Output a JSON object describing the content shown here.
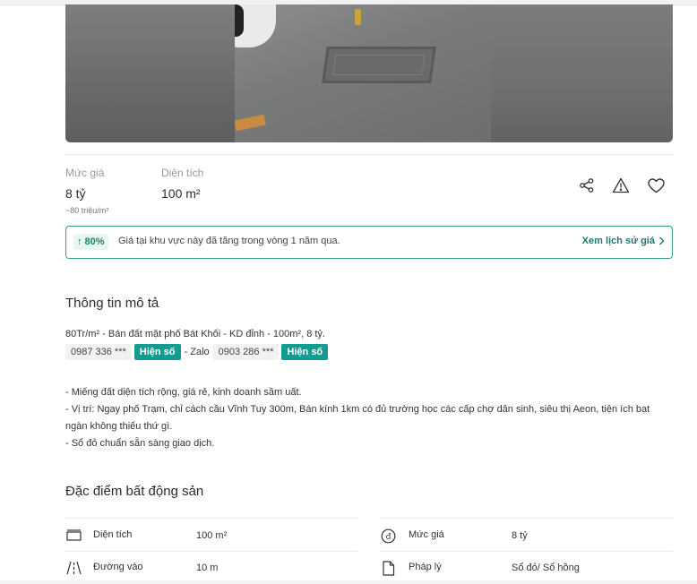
{
  "price_block": {
    "price_label": "Mức giá",
    "price_value": "8 tỷ",
    "price_per_m2": "~80 triệu/m²",
    "area_label": "Diện tích",
    "area_value": "100 m²",
    "icons": [
      "share-icon",
      "warning-icon",
      "heart-icon"
    ]
  },
  "trend_banner": {
    "badge": "↑ 80%",
    "text": "Giá tại khu vực này đã tăng trong vòng 1 năm qua.",
    "link": "Xem lịch sử giá"
  },
  "description": {
    "title": "Thông tin mô tả",
    "headline": "80Tr/m² - Bán đất mặt phố Bát Khối - KD đỉnh - 100m², 8 tỷ.",
    "phone1": "0987 336 ***",
    "reveal_label": "Hiện số",
    "zalo_sep": "- Zalo",
    "phone2": "0903 286 ***",
    "line1": "- Miếng đất diện tích rộng, giá rẻ, kinh doanh sầm uất.",
    "line2a": "- Vị trí: Ngay phố Trạm, chỉ cách cầu Vĩnh Tuy 300m, Bán kính 1km có đủ trường học các cấp chợ dân sinh, siêu thị Aeon, tiện ích bạt",
    "line2b": "ngàn không thiếu thứ gì.",
    "line3": "- Sổ đỏ chuẩn sẵn sàng giao dịch."
  },
  "features": {
    "title": "Đặc điểm bất động sản",
    "rows": [
      {
        "icon": "area-icon",
        "label": "Diện tích",
        "value": "100 m²",
        "icon2": "price-dong-icon",
        "label2": "Mức giá",
        "value2": "8 tỷ"
      },
      {
        "icon": "road-icon",
        "label": "Đường vào",
        "value": "10 m",
        "icon2": "document-icon",
        "label2": "Pháp lý",
        "value2": "Sổ đỏ/ Sổ hồng"
      }
    ]
  },
  "colors": {
    "accent": "#139b8f",
    "trend_green": "#19865f",
    "border_teal": "#3a9a8d"
  }
}
